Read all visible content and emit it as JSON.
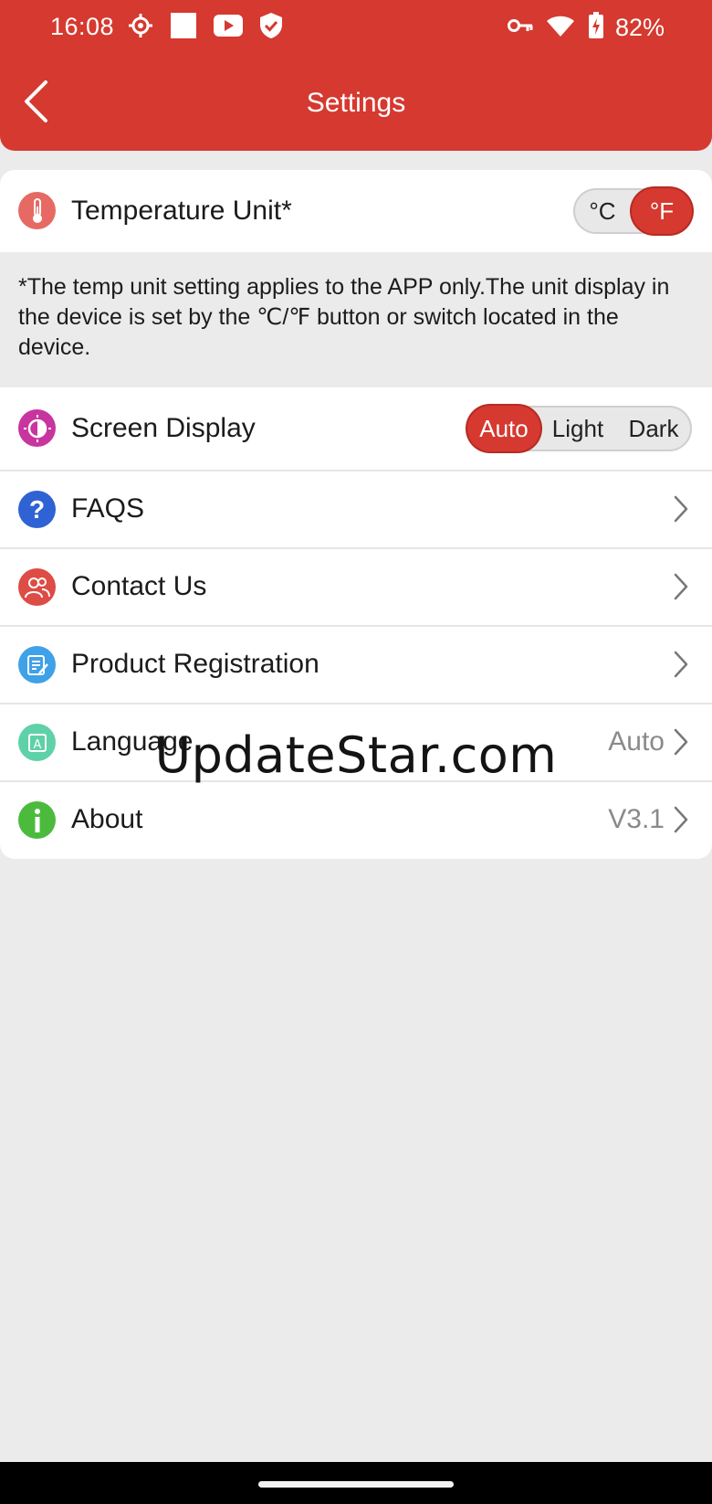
{
  "status_bar": {
    "time": "16:08",
    "battery": "82%"
  },
  "header": {
    "title": "Settings"
  },
  "temperature": {
    "label": "Temperature Unit*",
    "options": [
      "°C",
      "°F"
    ],
    "selected": "°F"
  },
  "note": "*The temp unit setting applies to the APP only.The unit display in the device is set by the ℃/℉ button or switch located in the device.",
  "screen_display": {
    "label": "Screen Display",
    "options": [
      "Auto",
      "Light",
      "Dark"
    ],
    "selected": "Auto"
  },
  "menu": [
    {
      "label": "FAQS",
      "value": ""
    },
    {
      "label": "Contact Us",
      "value": ""
    },
    {
      "label": "Product Registration",
      "value": ""
    },
    {
      "label": "Language",
      "value": "Auto"
    },
    {
      "label": "About",
      "value": "V3.1"
    }
  ],
  "watermark": "UpdateStar.com",
  "colors": {
    "brand_red": "#d5392f",
    "background": "#ebebeb",
    "temp_icon": "#e66a63",
    "display_icon": "#c8359f",
    "faq_icon": "#2f62d4",
    "contact_icon": "#dd4c45",
    "registration_icon": "#3fa1e8",
    "language_icon": "#5ed1a8",
    "about_icon": "#4cbb3d"
  }
}
